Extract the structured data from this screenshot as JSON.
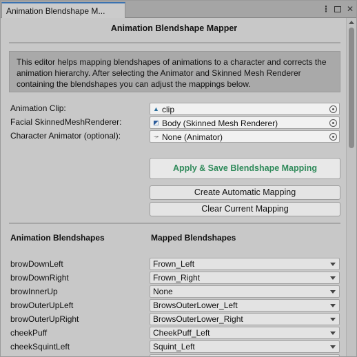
{
  "tab": {
    "title": "Animation Blendshape M...",
    "menu_icon": "kebab-menu-icon",
    "maximize_icon": "maximize-icon",
    "close_icon": "close-icon"
  },
  "header": {
    "title": "Animation Blendshape Mapper"
  },
  "help": {
    "text": "This editor helps mapping blendshapes of animations to a character and corrects the animation hierarchy. After selecting the Animator and Skinned Mesh Renderer containing the blendshapes you can adjust the mappings below."
  },
  "fields": {
    "animation_clip": {
      "label": "Animation Clip:",
      "value": "clip",
      "icon": "animation-clip-icon"
    },
    "facial_renderer": {
      "label": "Facial SkinnedMeshRenderer:",
      "value": "Body (Skinned Mesh Renderer)",
      "icon": "skinned-mesh-icon"
    },
    "character_animator": {
      "label": "Character Animator (optional):",
      "value": "None (Animator)",
      "icon": "animator-icon"
    }
  },
  "buttons": {
    "apply_save": "Apply & Save Blendshape Mapping",
    "create_auto": "Create Automatic Mapping",
    "clear": "Clear Current Mapping"
  },
  "columns": {
    "animation": "Animation Blendshapes",
    "mapped": "Mapped Blendshapes"
  },
  "mappings": [
    {
      "source": "browDownLeft",
      "target": "Frown_Left"
    },
    {
      "source": "browDownRight",
      "target": "Frown_Right"
    },
    {
      "source": "browInnerUp",
      "target": "None"
    },
    {
      "source": "browOuterUpLeft",
      "target": "BrowsOuterLower_Left"
    },
    {
      "source": "browOuterUpRight",
      "target": "BrowsOuterLower_Right"
    },
    {
      "source": "cheekPuff",
      "target": "CheekPuff_Left"
    },
    {
      "source": "cheekSquintLeft",
      "target": "Squint_Left"
    }
  ],
  "colors": {
    "window_bg": "#c8c8c8",
    "primary_button_text": "#2f8a5a",
    "active_tab_accent": "#3a72b0"
  }
}
